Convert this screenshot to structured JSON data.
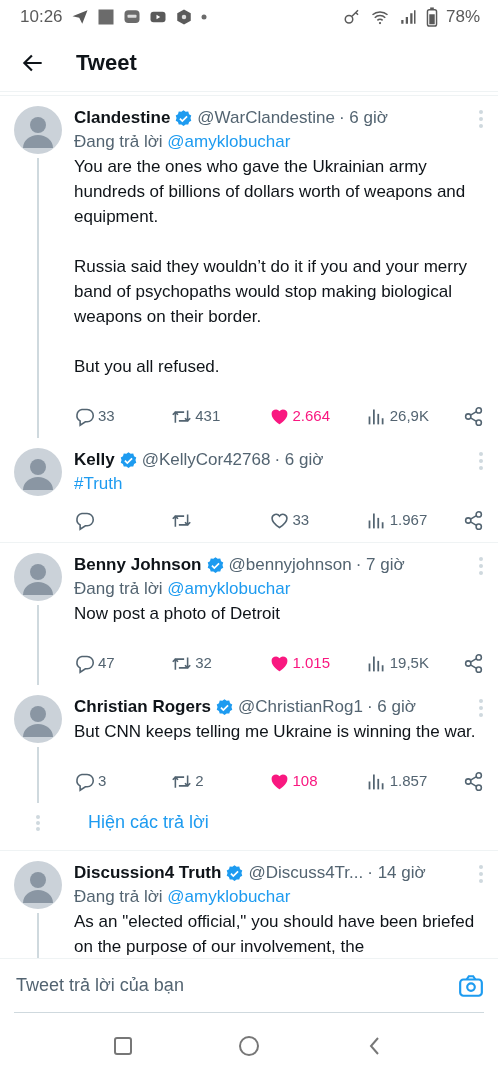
{
  "status_bar": {
    "time": "10:26",
    "battery": "78%"
  },
  "header": {
    "title": "Tweet"
  },
  "groups": [
    {
      "tweets": [
        {
          "name": "Clandestine",
          "verified": true,
          "handle": "@WarClandestine",
          "time": "· 6 giờ",
          "reply_prefix": "Đang trả lời",
          "reply_to": "@amyklobuchar",
          "paragraphs": [
            "You are the ones who gave the Ukrainian army hundreds of billions of dollars worth of weapons and equipment.",
            "Russia said they wouldn’t do it if you and your merry band of psychopaths would stop making biological weapons on their border.",
            "But you all refused."
          ],
          "connected": true,
          "actions": {
            "replies": "33",
            "retweets": "431",
            "likes": "2.664",
            "liked": true,
            "views": "26,9K"
          }
        },
        {
          "name": "Kelly",
          "verified": true,
          "handle": "@KellyCor42768",
          "time": "· 6 giờ",
          "hashtag": "#Truth",
          "connected": false,
          "actions": {
            "likes": "33",
            "liked": false,
            "views": "1.967"
          }
        }
      ]
    },
    {
      "tweets": [
        {
          "name": "Benny Johnson",
          "verified": true,
          "handle": "@bennyjohnson",
          "time": "· 7 giờ",
          "reply_prefix": "Đang trả lời",
          "reply_to": "@amyklobuchar",
          "paragraphs": [
            "Now post a photo of Detroit"
          ],
          "connected": true,
          "actions": {
            "replies": "47",
            "retweets": "32",
            "likes": "1.015",
            "liked": true,
            "views": "19,5K"
          }
        },
        {
          "name": "Christian Rogers",
          "verified": true,
          "handle": "@ChristianRog1",
          "time": "· 6 giờ",
          "paragraphs": [
            "But CNN keeps telling me Ukraine is winning the war."
          ],
          "connected": true,
          "actions": {
            "replies": "3",
            "retweets": "2",
            "likes": "108",
            "liked": true,
            "views": "1.857"
          }
        }
      ],
      "show_replies": "Hiện các trả lời"
    },
    {
      "tweets": [
        {
          "name": "Discussion4 Truth",
          "verified": true,
          "handle": "@Discuss4Tr...",
          "time": "· 14 giờ",
          "reply_prefix": "Đang trả lời",
          "reply_to": "@amyklobuchar",
          "paragraphs": [
            "As an \"elected official,\" you should have been briefed on the purpose of our involvement, the"
          ],
          "connected": true
        }
      ]
    }
  ],
  "composer": {
    "placeholder": "Tweet trả lời của bạn"
  }
}
